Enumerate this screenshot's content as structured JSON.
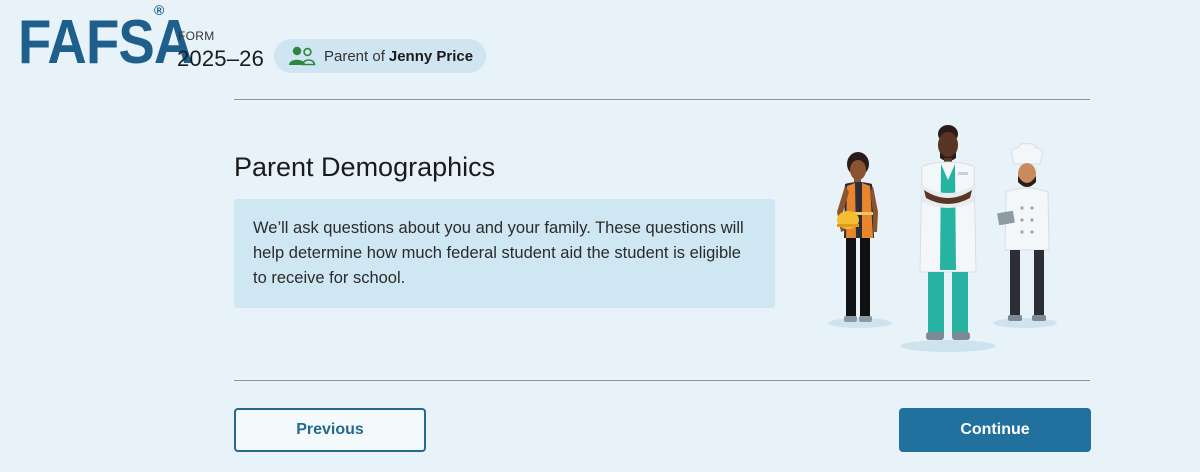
{
  "header": {
    "logo_text": "FAFSA",
    "logo_reg": "®",
    "form_label": "FORM",
    "form_year": "2025–26",
    "role": {
      "prefix": "Parent of",
      "name": "Jenny Price",
      "icon": "people-icon"
    }
  },
  "main": {
    "title": "Parent Demographics",
    "info_text": "We’ll ask questions about you and your family. These questions will help determine how much federal student aid the student is eligible to receive for school.",
    "illustration": "workers-illustration"
  },
  "footer": {
    "previous_label": "Previous",
    "continue_label": "Continue"
  },
  "colors": {
    "background": "#e8f3f9",
    "brand": "#1e5f8c",
    "primary_button": "#21709d",
    "info_box": "#cfe6f3",
    "pill": "#cfe5f2",
    "icon_green": "#2e8540"
  }
}
